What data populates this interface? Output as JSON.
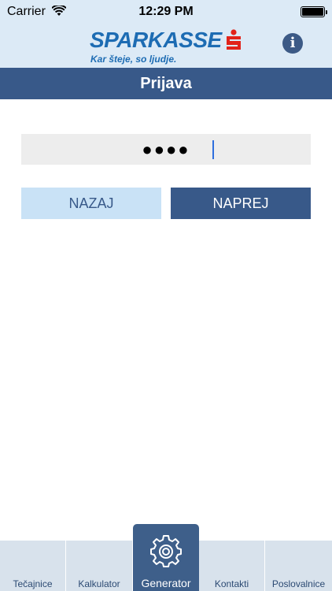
{
  "status_bar": {
    "carrier": "Carrier",
    "time": "12:29 PM"
  },
  "header": {
    "brand": "SPARKASSE",
    "tagline": "Kar šteje, so ljudje.",
    "info_icon": "i"
  },
  "title": "Prijava",
  "pin_field": {
    "value": "●●●●"
  },
  "buttons": {
    "back": "NAZAJ",
    "next": "NAPREJ"
  },
  "tabbar": {
    "tabs": [
      {
        "label": "Tečajnice"
      },
      {
        "label": "Kalkulator"
      },
      {
        "label": "Generator"
      },
      {
        "label": "Kontakti"
      },
      {
        "label": "Poslovalnice"
      }
    ],
    "active_index": 2,
    "active_icon": "gear-icon"
  },
  "colors": {
    "header_bg": "#dceaf6",
    "brand_blue": "#1d6cb3",
    "brand_red": "#e2231a",
    "primary": "#385989",
    "secondary_button": "#c9e2f6",
    "input_bg": "#ededed",
    "tab_bg": "#d8e2ec"
  }
}
